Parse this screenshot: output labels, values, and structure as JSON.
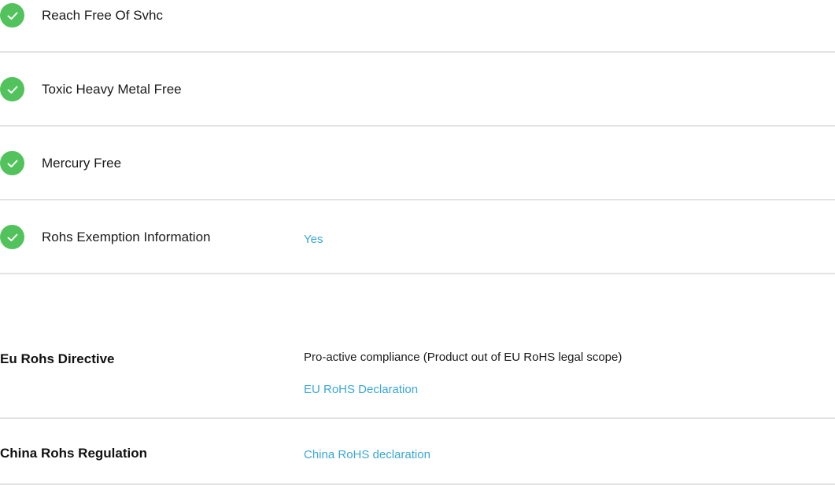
{
  "compliance_checks": [
    {
      "label": "Reach Free Of Svhc",
      "value": "",
      "icon": "check-circle-icon"
    },
    {
      "label": "Toxic Heavy Metal Free",
      "value": "",
      "icon": "check-circle-icon"
    },
    {
      "label": "Mercury Free",
      "value": "",
      "icon": "check-circle-icon"
    },
    {
      "label": "Rohs Exemption Information",
      "value": "Yes",
      "icon": "check-circle-icon"
    }
  ],
  "regulations": [
    {
      "label": "Eu Rohs Directive",
      "text": "Pro-active compliance (Product out of EU RoHS legal scope)",
      "link": "EU RoHS Declaration"
    },
    {
      "label": "China Rohs Regulation",
      "text": "",
      "link": "China RoHS declaration"
    }
  ],
  "colors": {
    "check_green": "#52c25c",
    "link_blue": "#3aa7d8",
    "divider": "#e3e3e3"
  }
}
